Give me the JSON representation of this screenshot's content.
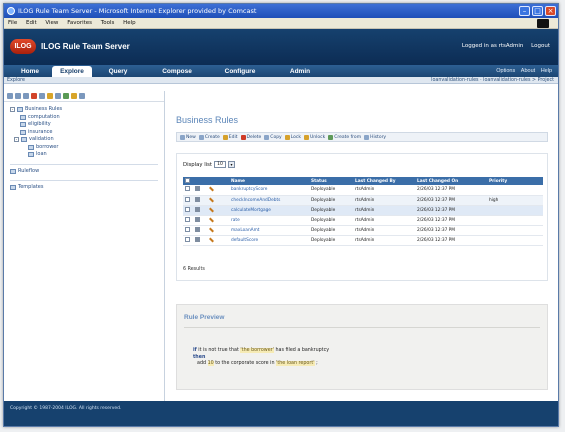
{
  "window": {
    "title": "ILOG Rule Team Server - Microsoft Internet Explorer provided by Comcast"
  },
  "menu": [
    "File",
    "Edit",
    "View",
    "Favorites",
    "Tools",
    "Help"
  ],
  "app": {
    "logo": "ILOG",
    "title": "ILOG Rule Team Server",
    "user_link": "Logged in as rtsAdmin",
    "signout": "Logout"
  },
  "nav": {
    "tabs": [
      "Home",
      "Explore",
      "Query",
      "Compose",
      "Configure",
      "Admin"
    ],
    "active": 1,
    "right": [
      "Options",
      "About",
      "Help"
    ]
  },
  "subbar": {
    "left": "Explore",
    "right": "loanvalidation-rules · loanvalidation-rules > Project"
  },
  "tree": {
    "root": "Business Rules",
    "items": [
      "computation",
      "eligibility",
      "insurance",
      "validation",
      "borrower",
      "loan"
    ],
    "other": [
      "Ruleflow",
      "Templates"
    ]
  },
  "main": {
    "heading": "Business Rules",
    "toolbar": [
      "New",
      "Create",
      "Edit",
      "Delete",
      "Copy",
      "Lock",
      "Unlock",
      "Create from",
      "History"
    ],
    "display_label": "Display list",
    "display_value": "10",
    "table": {
      "columns": [
        "",
        "",
        "",
        "Name",
        "Status",
        "Last Changed By",
        "Last Changed On",
        "Priority"
      ],
      "rows": [
        {
          "name": "bankruptcyScore",
          "status": "Deployable",
          "by": "rtsAdmin",
          "on": "2/26/03 12:37 PM",
          "priority": ""
        },
        {
          "name": "checkIncomeAndDebts",
          "status": "Deployable",
          "by": "rtsAdmin",
          "on": "2/26/03 12:37 PM",
          "priority": "high"
        },
        {
          "name": "calculateMortgage",
          "status": "Deployable",
          "by": "rtsAdmin",
          "on": "2/26/03 12:37 PM",
          "priority": ""
        },
        {
          "name": "rate",
          "status": "Deployable",
          "by": "rtsAdmin",
          "on": "2/26/03 12:37 PM",
          "priority": ""
        },
        {
          "name": "maxLoanAmt",
          "status": "Deployable",
          "by": "rtsAdmin",
          "on": "2/26/03 12:37 PM",
          "priority": ""
        },
        {
          "name": "defaultScore",
          "status": "Deployable",
          "by": "rtsAdmin",
          "on": "2/26/03 12:37 PM",
          "priority": ""
        }
      ]
    },
    "results": "6 Results",
    "preview": {
      "title": "Rule Preview",
      "if": "if",
      "if_text": "it is not true that",
      "if_str": "'the borrower'",
      "if_text2": "has filed a bankruptcy",
      "then": "then",
      "then_text": "add",
      "then_num": "10",
      "then_text2": "to the corporate score in",
      "then_str": "'the loan report'",
      "then_end": ";"
    }
  },
  "footer": "Copyright © 1987-2004 ILOG. All rights reserved."
}
